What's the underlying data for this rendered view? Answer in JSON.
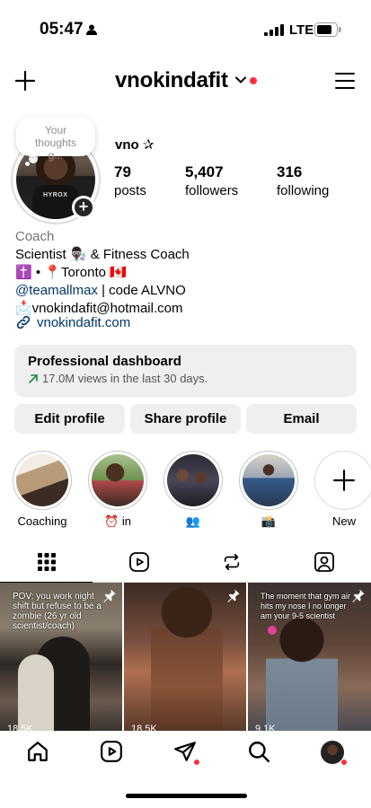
{
  "status_bar": {
    "time": "05:47",
    "network": "LTE"
  },
  "header": {
    "username": "vnokindafit"
  },
  "profile": {
    "note": "Your thoughts g...",
    "display_name": "vno ✰",
    "stats": [
      {
        "value": "79",
        "label": "posts"
      },
      {
        "value": "5,407",
        "label": "followers"
      },
      {
        "value": "316",
        "label": "following"
      }
    ],
    "category": "Coach",
    "bio_lines": [
      "Scientist 👨🏿‍🔬 & Fitness Coach",
      "✝️ • 📍Toronto 🇨🇦"
    ],
    "mention": "@teamallmax",
    "mention_suffix": " | code ALVNO",
    "email_line": "📩vnokindafit@hotmail.com",
    "link": "vnokindafit.com"
  },
  "dashboard": {
    "title": "Professional dashboard",
    "subtitle": "17.0M views in the last 30 days."
  },
  "buttons": {
    "edit": "Edit profile",
    "share": "Share profile",
    "email": "Email"
  },
  "highlights": [
    {
      "label": "Coaching"
    },
    {
      "label": "⏰ in"
    },
    {
      "label": "👥"
    },
    {
      "label": "📸"
    },
    {
      "label": "New"
    }
  ],
  "posts": [
    {
      "caption": "POV: you work night shift but refuse to be a zombie (26 yr old scientist/coach)",
      "views": "18.5K"
    },
    {
      "caption": "",
      "views": "18.5K"
    },
    {
      "caption": "The moment that gym air hits my nose I no longer am your 9-5 scientist",
      "views": "9.1K"
    }
  ],
  "colors": {
    "accent_red": "#ff3040",
    "link_blue": "#00376b",
    "button_bg": "#efefef"
  }
}
